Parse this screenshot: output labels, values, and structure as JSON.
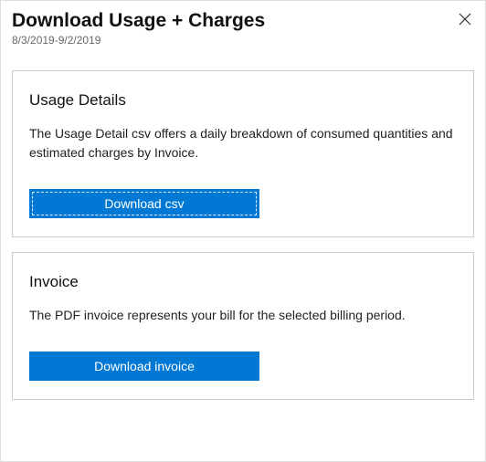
{
  "header": {
    "title": "Download Usage + Charges",
    "date_range": "8/3/2019-9/2/2019"
  },
  "sections": {
    "usage": {
      "title": "Usage Details",
      "description": "The Usage Detail csv offers a daily breakdown of consumed quantities and estimated charges by Invoice.",
      "button_label": "Download csv"
    },
    "invoice": {
      "title": "Invoice",
      "description": "The PDF invoice represents your bill for the selected billing period.",
      "button_label": "Download invoice"
    }
  }
}
